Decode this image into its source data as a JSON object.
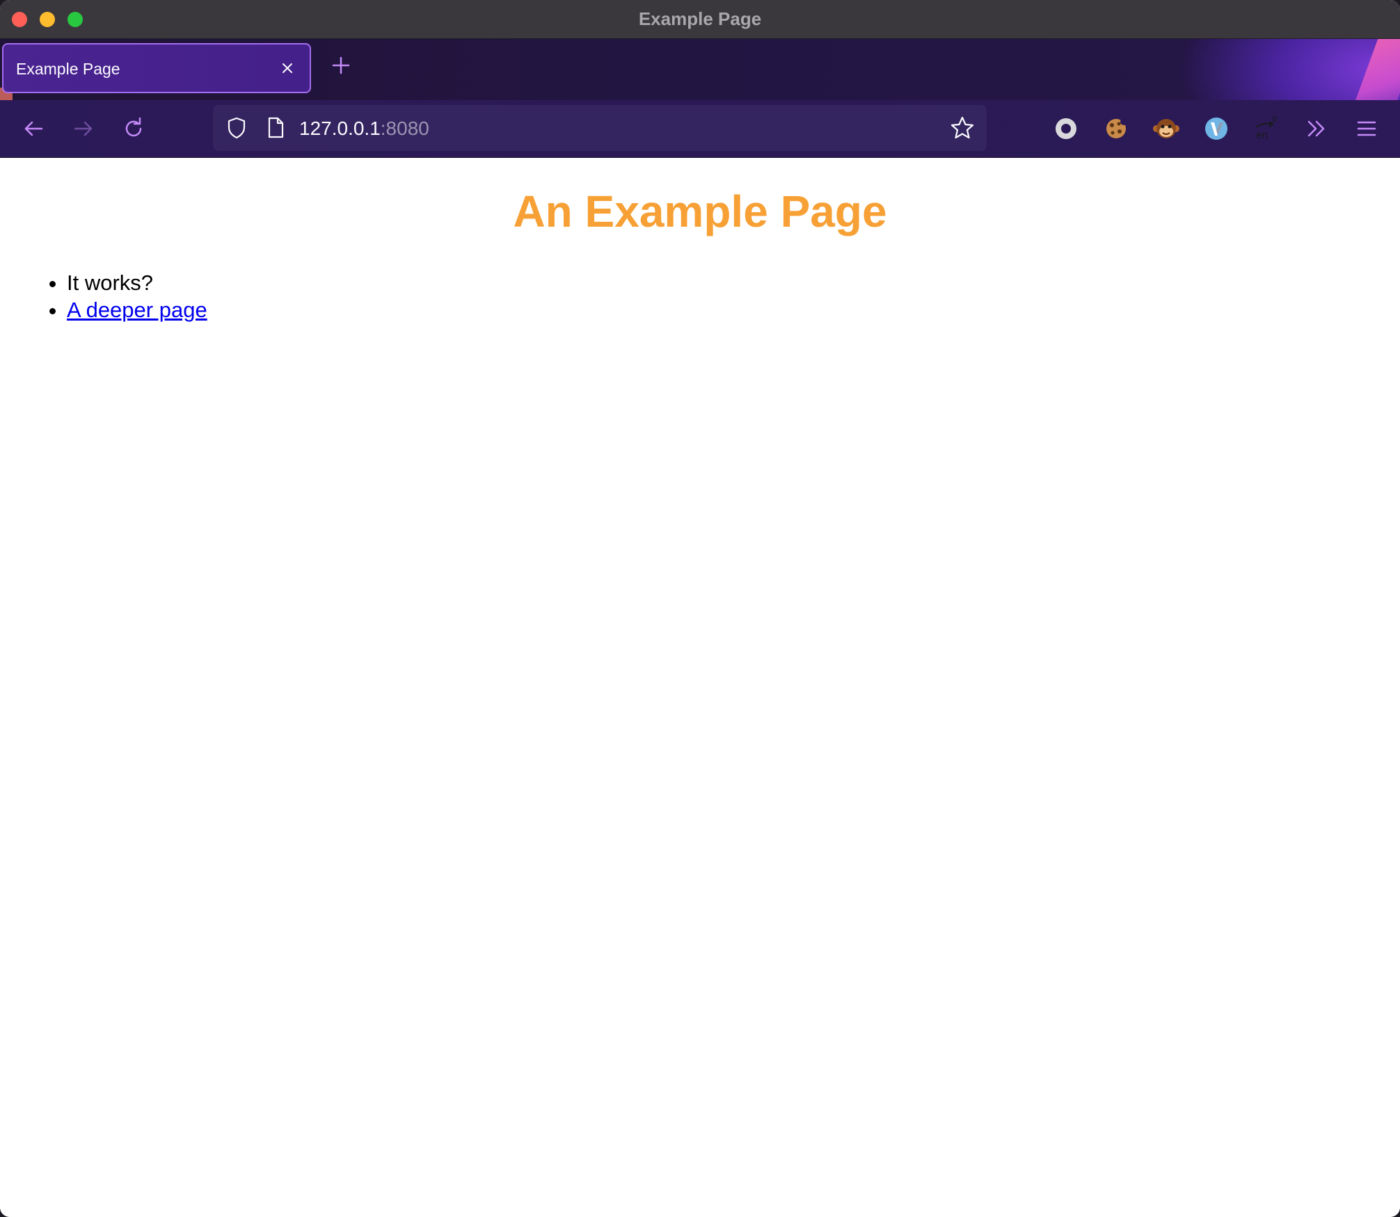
{
  "window": {
    "title": "Example Page"
  },
  "tabs": [
    {
      "label": "Example Page",
      "active": true
    }
  ],
  "toolbar": {
    "back_icon": "arrow-left-icon",
    "forward_icon": "arrow-right-icon",
    "reload_icon": "reload-icon",
    "url_host": "127.0.0.1",
    "url_port": ":8080",
    "extensions": [
      "record-extension-icon",
      "cookie-extension-icon",
      "tampermonkey-monkey-icon",
      "vimium-extension-icon",
      "translate-extension-icon"
    ],
    "overflow_icon": "chevron-double-right-icon",
    "menu_icon": "hamburger-menu-icon"
  },
  "page": {
    "heading": "An Example Page",
    "items": [
      {
        "text": "It works?"
      },
      {
        "text": "A deeper page",
        "link": true
      }
    ]
  },
  "colors": {
    "heading": "#f7a035",
    "link": "#0000ee",
    "accent": "#c58af9",
    "tab_border": "#a56ef0"
  }
}
